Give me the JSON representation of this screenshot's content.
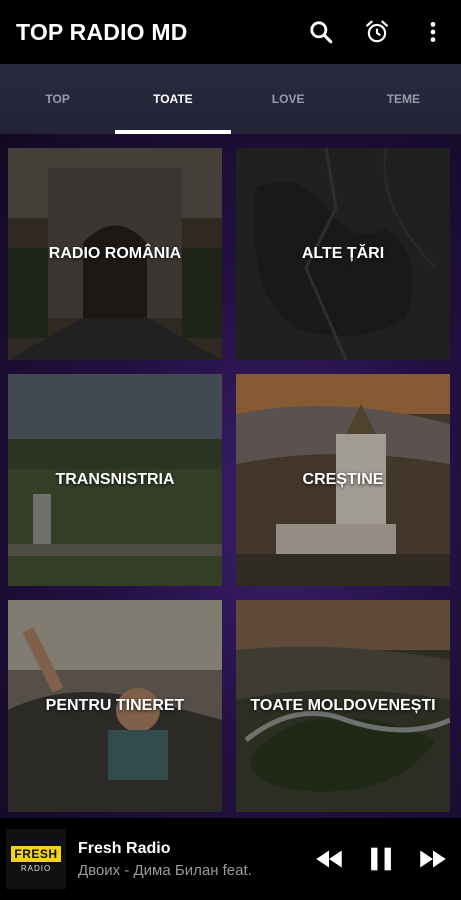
{
  "app": {
    "title": "TOP RADIO MD"
  },
  "appbar_icons": [
    "search-icon",
    "alarm-icon",
    "more-vertical-icon"
  ],
  "tabs": [
    {
      "label": "TOP",
      "active": false
    },
    {
      "label": "TOATE",
      "active": true
    },
    {
      "label": "LOVE",
      "active": false
    },
    {
      "label": "TEME",
      "active": false
    }
  ],
  "categories": [
    {
      "label": "RADIO ROMÂNIA"
    },
    {
      "label": "ALTE ȚĂRI"
    },
    {
      "label": "TRANSNISTRIA"
    },
    {
      "label": "CREȘTINE"
    },
    {
      "label": "PENTRU TINERET"
    },
    {
      "label": "TOATE MOLDOVENEȘTI"
    }
  ],
  "player": {
    "logo_top": "FRESH",
    "logo_bottom": "RADIO",
    "station": "Fresh Radio",
    "track": "Двоих - Дима Билан feat.",
    "controls": [
      "rewind-icon",
      "pause-icon",
      "fast-forward-icon"
    ]
  },
  "colors": {
    "tab_bar": "#2a2a3e",
    "grid_accent": "#3b1f6e",
    "logo_yellow": "#f2d21b"
  }
}
